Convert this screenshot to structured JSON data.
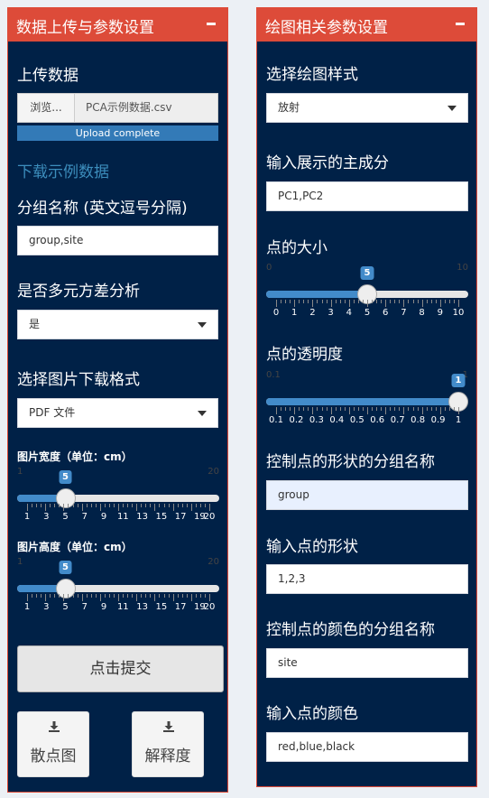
{
  "left_panel": {
    "title": "数据上传与参数设置",
    "upload_label": "上传数据",
    "browse_label": "浏览...",
    "file_name": "PCA示例数据.csv",
    "progress_text": "Upload complete",
    "progress_value": 1,
    "example_link": "下载示例数据",
    "group_label": "分组名称 (英文逗号分隔)",
    "group_value": "group,site",
    "manova_label": "是否多元方差分析",
    "manova_value": "是",
    "format_label": "选择图片下载格式",
    "format_value": "PDF 文件",
    "width_slider": {
      "label": "图片宽度（单位：cm）",
      "min": 1,
      "max": 20,
      "value": 5,
      "ticks": [
        1,
        3,
        5,
        7,
        9,
        11,
        13,
        15,
        17,
        19,
        20
      ],
      "labels": [
        "1",
        "3",
        "5",
        "7",
        "9",
        "11",
        "13",
        "15",
        "17",
        "19",
        "20"
      ]
    },
    "height_slider": {
      "label": "图片高度（单位：cm）",
      "min": 1,
      "max": 20,
      "value": 5,
      "ticks": [
        1,
        3,
        5,
        7,
        9,
        11,
        13,
        15,
        17,
        19,
        20
      ],
      "labels": [
        "1",
        "3",
        "5",
        "7",
        "9",
        "11",
        "13",
        "15",
        "17",
        "19",
        "20"
      ]
    },
    "submit_label": "点击提交",
    "download_scatter_label": "散点图",
    "download_explain_label": "解释度"
  },
  "right_panel": {
    "title": "绘图相关参数设置",
    "style_label": "选择绘图样式",
    "style_value": "放射",
    "pc_label": "输入展示的主成分",
    "pc_value": "PC1,PC2",
    "size_slider": {
      "label": "点的大小",
      "min": 0,
      "max": 10,
      "value": 5,
      "ticks": [
        0,
        1,
        2,
        3,
        4,
        5,
        6,
        7,
        8,
        9,
        10
      ],
      "labels": [
        "0",
        "1",
        "2",
        "3",
        "4",
        "5",
        "6",
        "7",
        "8",
        "9",
        "10"
      ]
    },
    "alpha_slider": {
      "label": "点的透明度",
      "min": 0.1,
      "max": 1,
      "value": 1,
      "ticks": [
        0.1,
        0.2,
        0.3,
        0.4,
        0.5,
        0.6,
        0.7,
        0.8,
        0.9,
        1
      ],
      "labels": [
        "0.1",
        "0.2",
        "0.3",
        "0.4",
        "0.5",
        "0.6",
        "0.7",
        "0.8",
        "0.9",
        "1"
      ]
    },
    "shape_group_label": "控制点的形状的分组名称",
    "shape_group_value": "group",
    "shape_label": "输入点的形状",
    "shape_value": "1,2,3",
    "color_group_label": "控制点的颜色的分组名称",
    "color_group_value": "site",
    "color_label": "输入点的颜色",
    "color_value": "red,blue,black"
  },
  "icons": {
    "collapse": "minus-icon",
    "download": "download-icon",
    "caret": "chevron-down-icon"
  },
  "colors": {
    "header": "#dd4b39",
    "panel": "#002147",
    "slider": "#428bca",
    "link": "#3c8dbc"
  }
}
